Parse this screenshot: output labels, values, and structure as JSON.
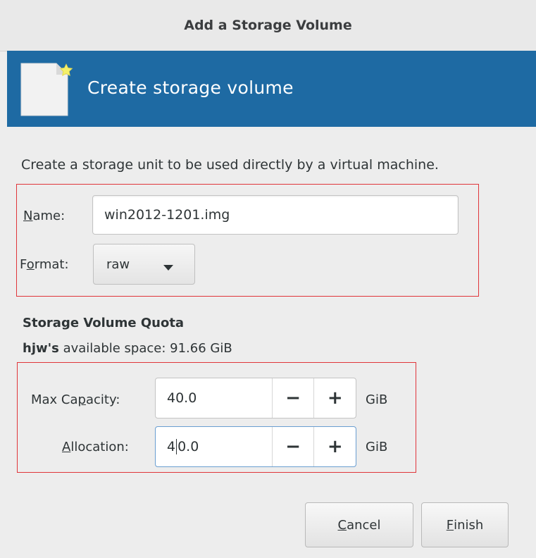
{
  "window": {
    "title": "Add a Storage Volume"
  },
  "header": {
    "title": "Create storage volume",
    "icon": "new-document-icon"
  },
  "description": "Create a storage unit to be used directly by a virtual machine.",
  "form": {
    "name_mnemonic": "N",
    "name_label_rest": "ame:",
    "name_value": "win2012-1201.img",
    "format_label_pre": "F",
    "format_mnemonic": "o",
    "format_label_rest": "rmat:",
    "format_value": "raw"
  },
  "quota": {
    "section_title": "Storage Volume Quota",
    "pool_name": "hjw's",
    "available_text": "available space: 91.66 GiB",
    "max_label_pre": "Max Ca",
    "max_mnemonic": "p",
    "max_label_rest": "acity:",
    "max_value": "40.0",
    "max_unit": "GiB",
    "alloc_mnemonic": "A",
    "alloc_label_rest": "llocation:",
    "alloc_value_before_cursor": "4",
    "alloc_value_after_cursor": "0.0",
    "alloc_unit": "GiB",
    "minus_symbol": "−",
    "plus_symbol": "+"
  },
  "buttons": {
    "cancel_mnemonic": "C",
    "cancel_rest": "ancel",
    "finish_mnemonic": "F",
    "finish_rest": "inish"
  },
  "colors": {
    "header_bg": "#1e6aa3",
    "highlight_border": "#e0353a",
    "focus_border": "#6a9ed1"
  }
}
